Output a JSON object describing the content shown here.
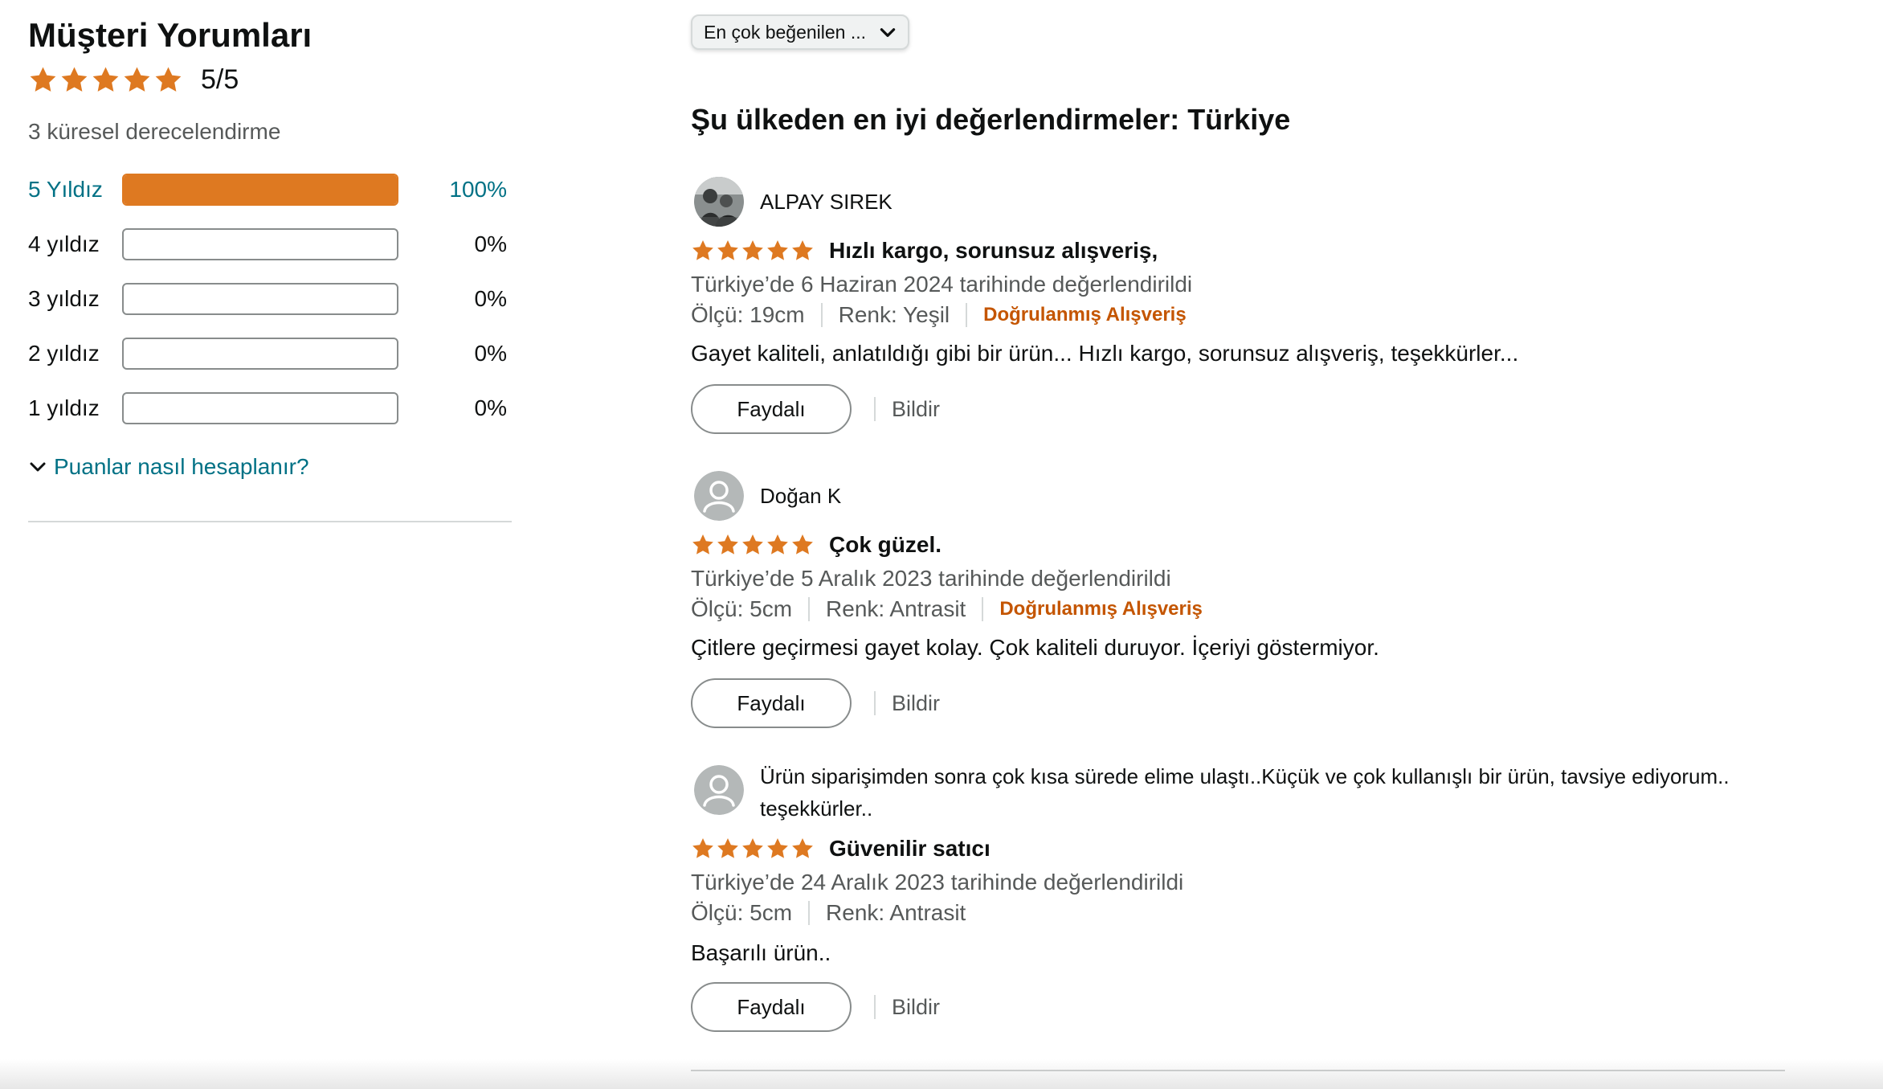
{
  "summary": {
    "title": "Müşteri Yorumları",
    "average_rating": 5,
    "average_text": "5/5",
    "global_ratings": "3 küresel derecelendirme",
    "histogram": [
      {
        "label": "5 Yıldız",
        "percent": 100,
        "percent_text": "100%"
      },
      {
        "label": "4 yıldız",
        "percent": 0,
        "percent_text": "0%"
      },
      {
        "label": "3 yıldız",
        "percent": 0,
        "percent_text": "0%"
      },
      {
        "label": "2 yıldız",
        "percent": 0,
        "percent_text": "0%"
      },
      {
        "label": "1 yıldız",
        "percent": 0,
        "percent_text": "0%"
      }
    ],
    "how_calculated_link": "Puanlar nasıl hesaplanır?"
  },
  "sort": {
    "selected": "En çok beğenilen ..."
  },
  "reviews_heading": "Şu ülkeden en iyi değerlendirmeler: Türkiye",
  "reviews": [
    {
      "author": "ALPAY SIREK",
      "rating": 5,
      "title": "Hızlı kargo, sorunsuz alışveriş,",
      "date": "Türkiye’de 6 Haziran 2024 tarihinde değerlendirildi",
      "size": "Ölçü: 19cm",
      "color": "Renk: Yeşil",
      "verified": "Doğrulanmış Alışveriş",
      "body": "Gayet kaliteli, anlatıldığı gibi bir ürün... Hızlı kargo, sorunsuz alışveriş, teşekkürler...",
      "helpful": "Faydalı",
      "report": "Bildir"
    },
    {
      "author": "Doğan K",
      "rating": 5,
      "title": "Çok güzel.",
      "date": "Türkiye’de 5 Aralık 2023 tarihinde değerlendirildi",
      "size": "Ölçü: 5cm",
      "color": "Renk: Antrasit",
      "verified": "Doğrulanmış Alışveriş",
      "body": "Çitlere geçirmesi gayet kolay. Çok kaliteli duruyor. İçeriyi göstermiyor.",
      "helpful": "Faydalı",
      "report": "Bildir"
    },
    {
      "author": "Ürün siparişimden sonra çok kısa sürede elime ulaştı..Küçük ve çok kullanışlı bir ürün, tavsiye ediyorum.. teşekkürler..",
      "rating": 5,
      "title": "Güvenilir satıcı",
      "date": "Türkiye’de 24 Aralık 2023 tarihinde değerlendirildi",
      "size": "Ölçü: 5cm",
      "color": "Renk: Antrasit",
      "body": "Başarılı ürün..",
      "helpful": "Faydalı",
      "report": "Bildir"
    }
  ],
  "icons": {
    "star": "star-icon",
    "chevron_down": "chevron-down-icon",
    "avatar": "avatar"
  },
  "colors": {
    "star": "#de7921",
    "link": "#007185",
    "verified": "#c45500",
    "muted_text": "#565959"
  }
}
